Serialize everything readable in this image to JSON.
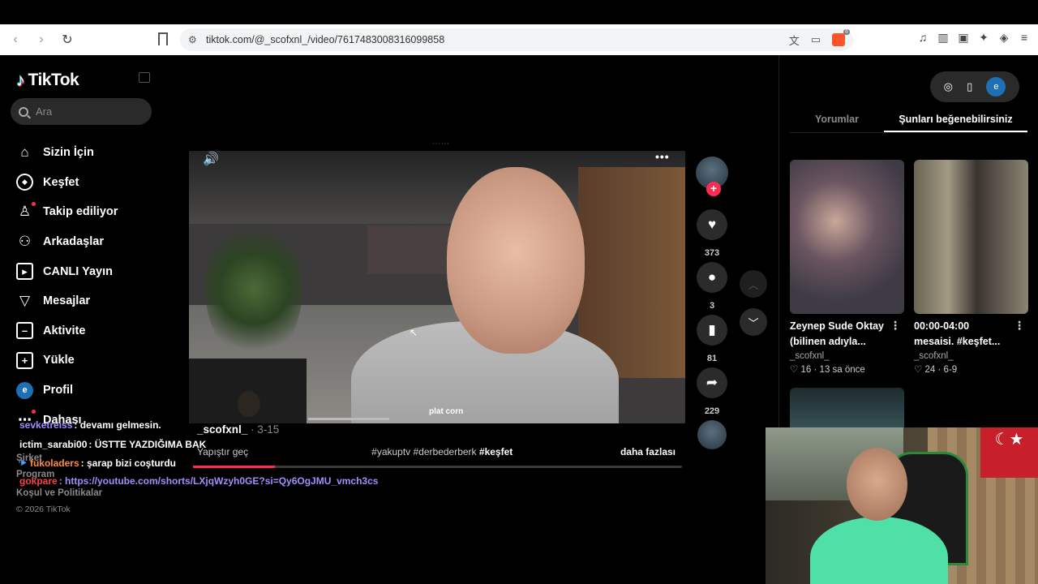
{
  "browser": {
    "url": "tiktok.com/@_scofxnl_/video/7617483008316099858",
    "brave_count": "6"
  },
  "sidebar": {
    "logo": "TikTok",
    "search_placeholder": "Ara",
    "items": [
      {
        "label": "Sizin İçin",
        "icon": "home-icon"
      },
      {
        "label": "Keşfet",
        "icon": "compass-icon"
      },
      {
        "label": "Takip ediliyor",
        "icon": "following-icon"
      },
      {
        "label": "Arkadaşlar",
        "icon": "friends-icon"
      },
      {
        "label": "CANLI Yayın",
        "icon": "live-icon"
      },
      {
        "label": "Mesajlar",
        "icon": "message-icon"
      },
      {
        "label": "Aktivite",
        "icon": "activity-icon"
      },
      {
        "label": "Yükle",
        "icon": "upload-icon"
      },
      {
        "label": "Profil",
        "icon": "profile-avatar"
      },
      {
        "label": "Dahası",
        "icon": "more-icon"
      }
    ],
    "profile_initial": "e",
    "footer": {
      "company": "Şirket",
      "program": "Program",
      "terms": "Koşul ve Politikalar",
      "copyright": "© 2026 TikTok"
    }
  },
  "chat": [
    {
      "user": "sevketreiss",
      "msg": ": devamı gelmesin.",
      "color": "#a58cff"
    },
    {
      "user": "ictim_sarabi00",
      "msg": ": ÜSTTE YAZDIĞIMA BAK",
      "color": "#ffffff"
    },
    {
      "user": "fukoladers",
      "msg": ": şarap bizi coşturdu",
      "color": "#ff8c3c"
    },
    {
      "user": "gokpare",
      "msg": ": https://youtube.com/shorts/LXjqWzyh0GE?si=Qy6OgJMU_vmch3cs",
      "color": "#ff4040"
    }
  ],
  "video": {
    "author": "_scofxnl_",
    "date": "· 3-15",
    "caption": "Yapıştır geç",
    "tags_plain": "#yakuptv #derbederberk ",
    "tag_highlight": "#keşfet",
    "more": "daha fazlası",
    "watermark": "plat corn",
    "progress": 0.167
  },
  "actions": {
    "likes": "373",
    "comments": "3",
    "saves": "81",
    "shares": "229"
  },
  "right_panel": {
    "tabs": [
      "Yorumlar",
      "Şunları beğenebilirsiniz"
    ],
    "active_tab": "Şunları beğenebilirsiniz",
    "cards": [
      {
        "title_line1": "Zeynep Sude Oktay",
        "title_line2": "(bilinen adıyla...",
        "author": "_scofxnl_",
        "likes": "16",
        "date": "13 sa önce"
      },
      {
        "title_line1": "00:00-04:00",
        "title_line2": "mesaisi. #keşfet...",
        "author": "_scofxnl_",
        "likes": "24",
        "date": "6-9"
      }
    ]
  },
  "colors": {
    "accent": "#fe2c55",
    "background": "#000000"
  }
}
